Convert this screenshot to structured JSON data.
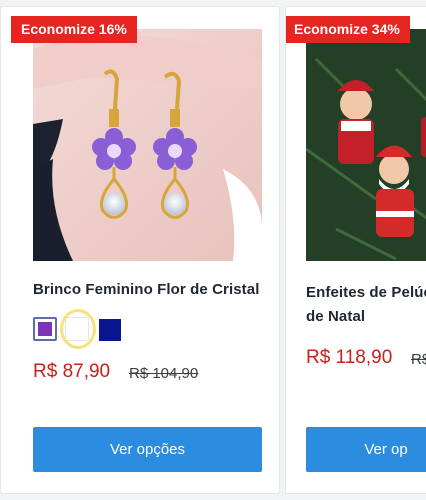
{
  "products": [
    {
      "badge": "Economize 16%",
      "title": "Brinco Feminino Flor de Cristal",
      "price": "R$ 87,90",
      "old_price": "R$ 104,90",
      "button": "Ver opções",
      "swatches": [
        "#7b35b8",
        "#ffffff",
        "#0a1590"
      ]
    },
    {
      "badge": "Economize 34%",
      "title_line1": "Enfeites de Pelúc",
      "title_line2": "de Natal",
      "price": "R$ 118,90",
      "old_price": "R$",
      "button": "Ver op"
    }
  ],
  "colors": {
    "badge": "#e5251f",
    "price": "#c8201a",
    "button": "#2b8ce0"
  }
}
